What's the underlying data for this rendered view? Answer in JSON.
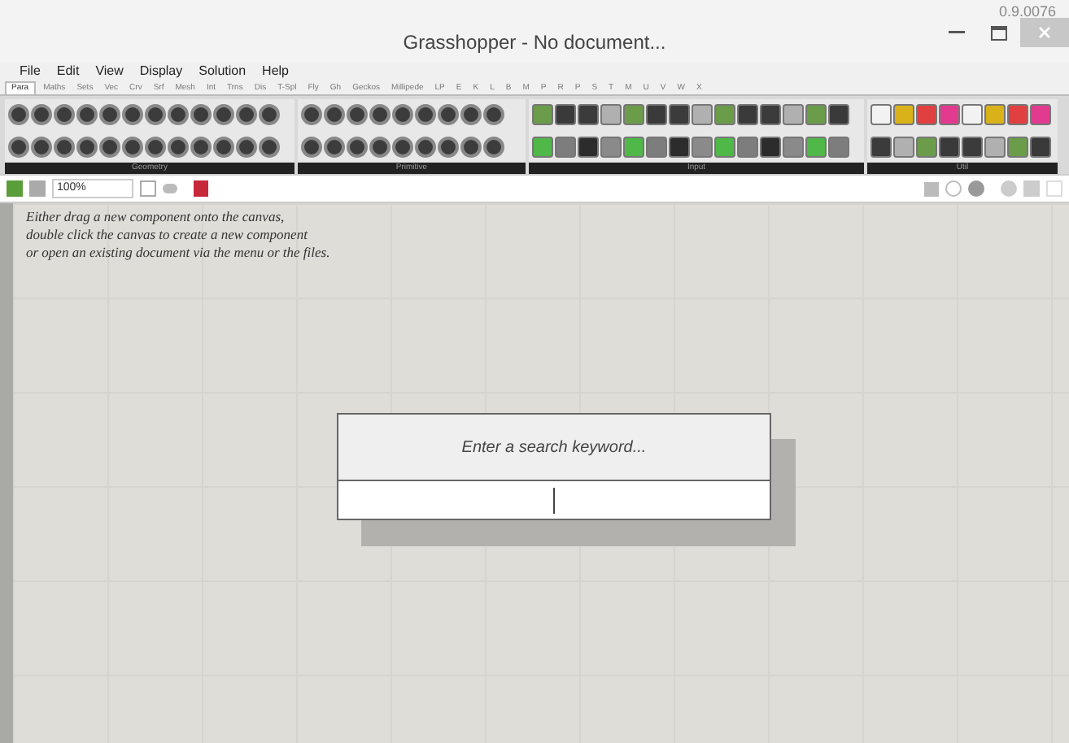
{
  "version": "0.9.0076",
  "window": {
    "title": "Grasshopper - No document..."
  },
  "menu": [
    "File",
    "Edit",
    "View",
    "Display",
    "Solution",
    "Help"
  ],
  "tabs": [
    {
      "label": "Para",
      "selected": true
    },
    {
      "label": "Maths",
      "selected": false
    },
    {
      "label": "Sets",
      "selected": false
    },
    {
      "label": "Vec",
      "selected": false
    },
    {
      "label": "Crv",
      "selected": false
    },
    {
      "label": "Srf",
      "selected": false
    },
    {
      "label": "Mesh",
      "selected": false
    },
    {
      "label": "Int",
      "selected": false
    },
    {
      "label": "Trns",
      "selected": false
    },
    {
      "label": "Dis",
      "selected": false
    },
    {
      "label": "T-Spl",
      "selected": false
    },
    {
      "label": "Fly",
      "selected": false
    },
    {
      "label": "Gh",
      "selected": false
    },
    {
      "label": "Geckos",
      "selected": false
    },
    {
      "label": "Millipede",
      "selected": false
    },
    {
      "label": "LP",
      "selected": false
    },
    {
      "label": "E",
      "selected": false
    },
    {
      "label": "K",
      "selected": false
    },
    {
      "label": "L",
      "selected": false
    },
    {
      "label": "B",
      "selected": false
    },
    {
      "label": "M",
      "selected": false
    },
    {
      "label": "P",
      "selected": false
    },
    {
      "label": "R",
      "selected": false
    },
    {
      "label": "P",
      "selected": false
    },
    {
      "label": "S",
      "selected": false
    },
    {
      "label": "T",
      "selected": false
    },
    {
      "label": "M",
      "selected": false
    },
    {
      "label": "U",
      "selected": false
    },
    {
      "label": "V",
      "selected": false
    },
    {
      "label": "W",
      "selected": false
    },
    {
      "label": "X",
      "selected": false
    }
  ],
  "panel_groups": [
    {
      "label": "Geometry",
      "kind": "round"
    },
    {
      "label": "Primitive",
      "kind": "round"
    },
    {
      "label": "Input",
      "kind": "square"
    },
    {
      "label": "Util",
      "kind": "square"
    }
  ],
  "canvas_toolbar": {
    "zoom": "100%"
  },
  "canvas": {
    "hint_lines": [
      "Either drag a new component onto the canvas,",
      "double click the canvas to create a new component",
      "or open an existing document via the menu or the files."
    ]
  },
  "search_dialog": {
    "prompt": "Enter a search keyword..."
  }
}
